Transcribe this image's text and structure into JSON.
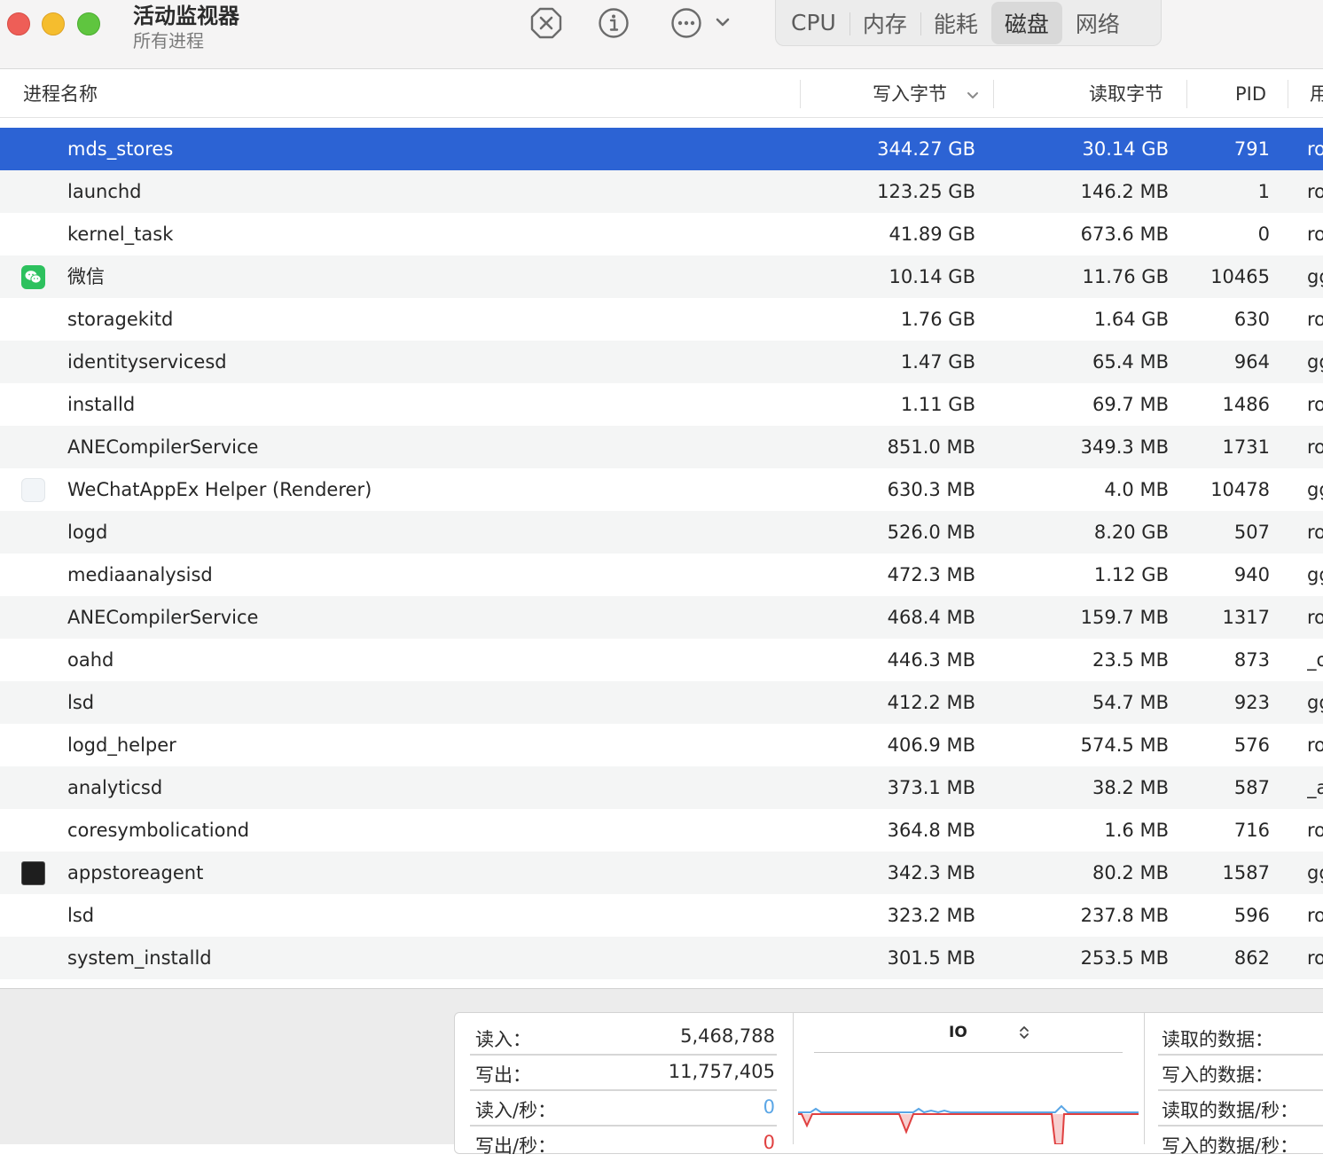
{
  "window": {
    "title": "活动监视器",
    "subtitle": "所有进程"
  },
  "toolbar": {
    "icons": [
      "stop-process-icon",
      "info-icon",
      "more-options-icon",
      "chevron-down-icon"
    ],
    "tabs": [
      {
        "label": "CPU",
        "active": false
      },
      {
        "label": "内存",
        "active": false
      },
      {
        "label": "能耗",
        "active": false
      },
      {
        "label": "磁盘",
        "active": true
      },
      {
        "label": "网络",
        "active": false
      }
    ]
  },
  "table": {
    "columns": {
      "name": "进程名称",
      "write": "写入字节",
      "read": "读取字节",
      "pid": "PID",
      "user": "用"
    },
    "sort_column": "write",
    "sort_direction": "descending",
    "rows": [
      {
        "name": "mds_stores",
        "write": "344.27 GB",
        "read": "30.14 GB",
        "pid": "791",
        "user": "ro",
        "icon": "",
        "selected": true
      },
      {
        "name": "launchd",
        "write": "123.25 GB",
        "read": "146.2 MB",
        "pid": "1",
        "user": "ro",
        "icon": ""
      },
      {
        "name": "kernel_task",
        "write": "41.89 GB",
        "read": "673.6 MB",
        "pid": "0",
        "user": "ro",
        "icon": ""
      },
      {
        "name": "微信",
        "write": "10.14 GB",
        "read": "11.76 GB",
        "pid": "10465",
        "user": "gg",
        "icon": "wechat-icon"
      },
      {
        "name": "storagekitd",
        "write": "1.76 GB",
        "read": "1.64 GB",
        "pid": "630",
        "user": "ro",
        "icon": ""
      },
      {
        "name": "identityservicesd",
        "write": "1.47 GB",
        "read": "65.4 MB",
        "pid": "964",
        "user": "gg",
        "icon": ""
      },
      {
        "name": "installd",
        "write": "1.11 GB",
        "read": "69.7 MB",
        "pid": "1486",
        "user": "ro",
        "icon": ""
      },
      {
        "name": "ANECompilerService",
        "write": "851.0 MB",
        "read": "349.3 MB",
        "pid": "1731",
        "user": "ro",
        "icon": ""
      },
      {
        "name": "WeChatAppEx Helper (Renderer)",
        "write": "630.3 MB",
        "read": "4.0 MB",
        "pid": "10478",
        "user": "gg",
        "icon": "wechat-appex-icon"
      },
      {
        "name": "logd",
        "write": "526.0 MB",
        "read": "8.20 GB",
        "pid": "507",
        "user": "ro",
        "icon": ""
      },
      {
        "name": "mediaanalysisd",
        "write": "472.3 MB",
        "read": "1.12 GB",
        "pid": "940",
        "user": "gg",
        "icon": ""
      },
      {
        "name": "ANECompilerService",
        "write": "468.4 MB",
        "read": "159.7 MB",
        "pid": "1317",
        "user": "ro",
        "icon": ""
      },
      {
        "name": "oahd",
        "write": "446.3 MB",
        "read": "23.5 MB",
        "pid": "873",
        "user": "_o",
        "icon": ""
      },
      {
        "name": "lsd",
        "write": "412.2 MB",
        "read": "54.7 MB",
        "pid": "923",
        "user": "gg",
        "icon": ""
      },
      {
        "name": "logd_helper",
        "write": "406.9 MB",
        "read": "574.5 MB",
        "pid": "576",
        "user": "ro",
        "icon": ""
      },
      {
        "name": "analyticsd",
        "write": "373.1 MB",
        "read": "38.2 MB",
        "pid": "587",
        "user": "_a",
        "icon": ""
      },
      {
        "name": "coresymbolicationd",
        "write": "364.8 MB",
        "read": "1.6 MB",
        "pid": "716",
        "user": "ro",
        "icon": ""
      },
      {
        "name": "appstoreagent",
        "write": "342.3 MB",
        "read": "80.2 MB",
        "pid": "1587",
        "user": "gg",
        "icon": "terminal-icon"
      },
      {
        "name": "lsd",
        "write": "323.2 MB",
        "read": "237.8 MB",
        "pid": "596",
        "user": "ro",
        "icon": ""
      },
      {
        "name": "system_installd",
        "write": "301.5 MB",
        "read": "253.5 MB",
        "pid": "862",
        "user": "ro",
        "icon": ""
      }
    ]
  },
  "summary": {
    "left": [
      {
        "label": "读入：",
        "value": "5,468,788",
        "color": "default"
      },
      {
        "label": "写出：",
        "value": "11,757,405",
        "color": "default"
      },
      {
        "label": "读入/秒：",
        "value": "0",
        "color": "#5aa6e6"
      },
      {
        "label": "写出/秒：",
        "value": "0",
        "color": "#e04040"
      }
    ],
    "graph": {
      "selector_label": "IO",
      "read_color": "#5aa6e6",
      "write_color": "#e04040"
    },
    "right": [
      {
        "label": "读取的数据："
      },
      {
        "label": "写入的数据："
      },
      {
        "label": "读取的数据/秒："
      },
      {
        "label": "写入的数据/秒："
      }
    ]
  }
}
